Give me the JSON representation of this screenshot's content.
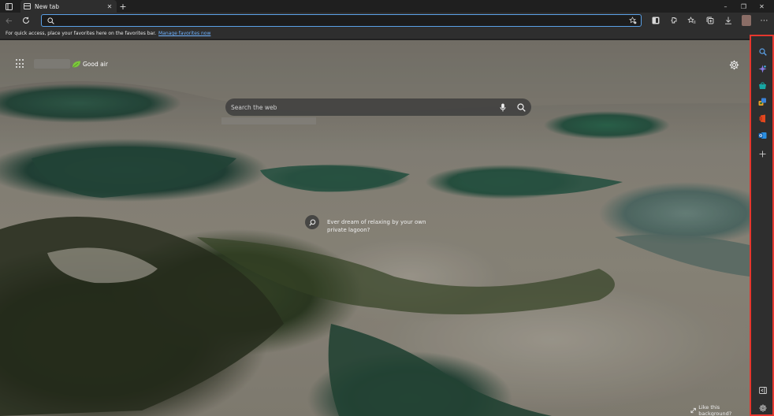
{
  "browser": {
    "tab_title": "New tab",
    "tab_close": "✕",
    "new_tab": "+",
    "window": {
      "minimize": "–",
      "maximize": "❐",
      "close": "✕"
    }
  },
  "toolbar": {
    "address_value": "",
    "more": "⋯"
  },
  "favorites_bar": {
    "message": "For quick access, place your favorites here on the favorites bar.",
    "link": "Manage favorites now"
  },
  "newtab": {
    "weather": "Good air",
    "search_placeholder": "Search the web",
    "promo_text": "Ever dream of relaxing by your own private lagoon?",
    "like_background": "Like this background?"
  },
  "colors": {
    "accent": "#5aa0e6",
    "sidebar_border": "#e5372e",
    "link": "#6fb2ff"
  },
  "sidebar": {
    "icons": [
      "search-icon",
      "copilot-icon",
      "shopping-icon",
      "games-icon",
      "office-icon",
      "outlook-icon",
      "add-icon",
      "hide-sidebar-icon",
      "sidebar-settings-icon"
    ]
  }
}
